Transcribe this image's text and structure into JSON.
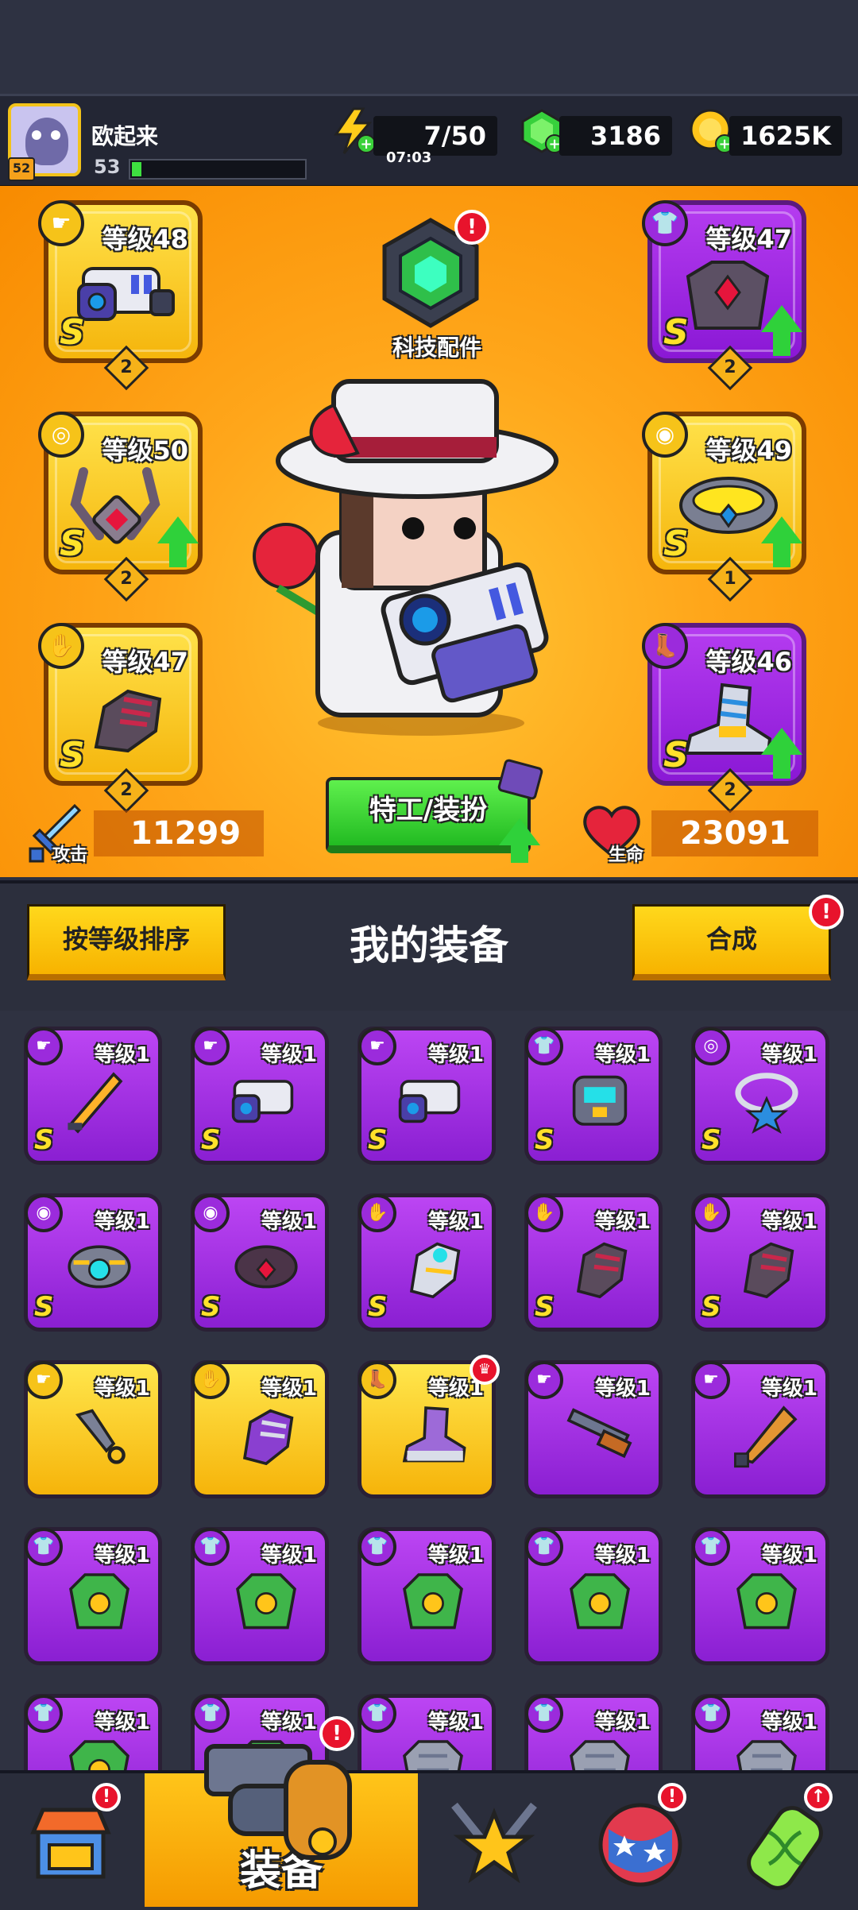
{
  "player": {
    "name": "欧起来",
    "level": "53",
    "vip_level": "52"
  },
  "resources": {
    "energy": {
      "value": "7/50",
      "timer": "07:03",
      "icon": "lightning-icon"
    },
    "gems": {
      "value": "3186",
      "icon": "gem-icon"
    },
    "coins": {
      "value": "1625K",
      "icon": "coin-icon"
    }
  },
  "equipped": {
    "weapon": {
      "label": "等级48",
      "stars": "2",
      "rank": "S",
      "icon": "weapon-icon"
    },
    "necklace": {
      "label": "等级50",
      "stars": "2",
      "rank": "S",
      "icon": "necklace-icon"
    },
    "gloves": {
      "label": "等级47",
      "stars": "2",
      "rank": "S",
      "icon": "gloves-icon"
    },
    "armor": {
      "label": "等级47",
      "stars": "2",
      "rank": "S",
      "icon": "armor-icon"
    },
    "belt": {
      "label": "等级49",
      "stars": "1",
      "rank": "S",
      "icon": "belt-icon"
    },
    "boots": {
      "label": "等级46",
      "stars": "2",
      "rank": "S",
      "icon": "boots-icon"
    }
  },
  "tech_parts": {
    "label": "科技配件",
    "badge": "!"
  },
  "agent_button": {
    "label": "特工/装扮"
  },
  "stats": {
    "attack_label": "攻击",
    "attack": "11299",
    "hp_label": "生命",
    "hp": "23091"
  },
  "inventory_header": {
    "sort_button": "按等级排序",
    "title": "我的装备",
    "merge_button": "合成",
    "merge_badge": "!"
  },
  "inventory": [
    {
      "label": "等级1",
      "rarity": "purple",
      "rank": "S",
      "type": "weapon",
      "item": "sword"
    },
    {
      "label": "等级1",
      "rarity": "purple",
      "rank": "S",
      "type": "weapon",
      "item": "blaster"
    },
    {
      "label": "等级1",
      "rarity": "purple",
      "rank": "S",
      "type": "weapon",
      "item": "blaster"
    },
    {
      "label": "等级1",
      "rarity": "purple",
      "rank": "S",
      "type": "armor",
      "item": "robot-armor"
    },
    {
      "label": "等级1",
      "rarity": "purple",
      "rank": "S",
      "type": "necklace",
      "item": "star-necklace"
    },
    {
      "label": "等级1",
      "rarity": "purple",
      "rank": "S",
      "type": "belt",
      "item": "blue-belt"
    },
    {
      "label": "等级1",
      "rarity": "purple",
      "rank": "S",
      "type": "belt",
      "item": "red-belt"
    },
    {
      "label": "等级1",
      "rarity": "purple",
      "rank": "S",
      "type": "gloves",
      "item": "gold-gauntlet"
    },
    {
      "label": "等级1",
      "rarity": "purple",
      "rank": "S",
      "type": "gloves",
      "item": "dark-gauntlet"
    },
    {
      "label": "等级1",
      "rarity": "purple",
      "rank": "S",
      "type": "gloves",
      "item": "dark-gauntlet"
    },
    {
      "label": "等级1",
      "rarity": "gold",
      "rank": "",
      "type": "weapon",
      "item": "kunai"
    },
    {
      "label": "等级1",
      "rarity": "gold",
      "rank": "",
      "type": "gloves",
      "item": "purple-gauntlet"
    },
    {
      "label": "等级1",
      "rarity": "gold",
      "rank": "",
      "type": "boots",
      "item": "purple-boot",
      "badge": true
    },
    {
      "label": "等级1",
      "rarity": "purple",
      "rank": "",
      "type": "weapon",
      "item": "shotgun"
    },
    {
      "label": "等级1",
      "rarity": "purple",
      "rank": "",
      "type": "weapon",
      "item": "bat"
    },
    {
      "label": "等级1",
      "rarity": "purple",
      "rank": "",
      "type": "armor",
      "item": "leaf-armor"
    },
    {
      "label": "等级1",
      "rarity": "purple",
      "rank": "",
      "type": "armor",
      "item": "leaf-armor"
    },
    {
      "label": "等级1",
      "rarity": "purple",
      "rank": "",
      "type": "armor",
      "item": "leaf-armor"
    },
    {
      "label": "等级1",
      "rarity": "purple",
      "rank": "",
      "type": "armor",
      "item": "leaf-armor"
    },
    {
      "label": "等级1",
      "rarity": "purple",
      "rank": "",
      "type": "armor",
      "item": "leaf-armor"
    },
    {
      "label": "等级1",
      "rarity": "purple",
      "rank": "",
      "type": "armor",
      "item": "leaf-armor"
    },
    {
      "label": "等级1",
      "rarity": "purple",
      "rank": "",
      "type": "armor",
      "item": "leaf-armor"
    },
    {
      "label": "等级1",
      "rarity": "purple",
      "rank": "",
      "type": "armor",
      "item": "stone-armor"
    },
    {
      "label": "等级1",
      "rarity": "purple",
      "rank": "",
      "type": "armor",
      "item": "stone-armor"
    },
    {
      "label": "等级1",
      "rarity": "purple",
      "rank": "",
      "type": "armor",
      "item": "stone-armor"
    }
  ],
  "nav": {
    "tabs": [
      {
        "name": "shop",
        "icon": "shop-icon",
        "badge": "!"
      },
      {
        "name": "equipment",
        "icon": "revolver-icon",
        "label": "装备",
        "active": true,
        "badge": "!"
      },
      {
        "name": "battle",
        "icon": "star-swords-icon"
      },
      {
        "name": "talent",
        "icon": "star-ball-icon",
        "badge": "!"
      },
      {
        "name": "evolve",
        "icon": "dna-capsule-icon",
        "badge": "↑"
      }
    ]
  },
  "colors": {
    "accent_orange": "#f7a11a",
    "gold": "#f6c319",
    "purple": "#9b2bdc",
    "green": "#2fd13a",
    "badge_red": "#e8132c"
  }
}
